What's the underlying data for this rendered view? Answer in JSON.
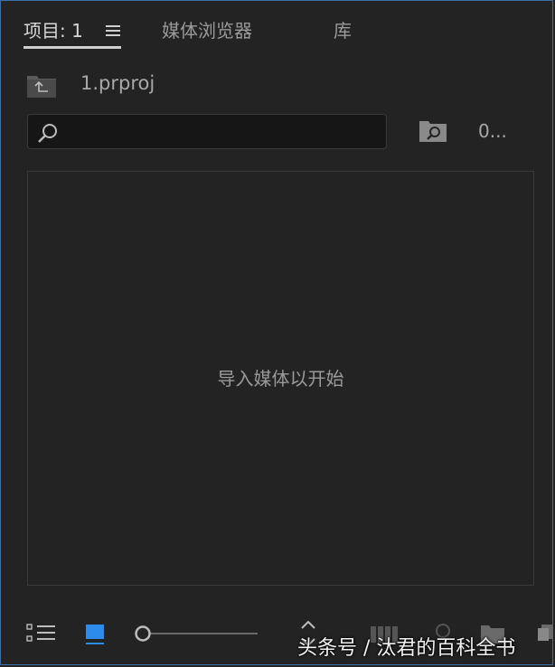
{
  "tabs": [
    {
      "label": "项目: 1",
      "active": true
    },
    {
      "label": "媒体浏览器",
      "active": false
    },
    {
      "label": "库",
      "active": false
    }
  ],
  "project": {
    "name": "1.prproj"
  },
  "search": {
    "placeholder": "",
    "value": ""
  },
  "item_count": "0...",
  "content": {
    "empty_hint": "导入媒体以开始"
  },
  "toolbar": {
    "icons": [
      "list-view-icon",
      "icon-view-icon",
      "zoom-slider",
      "sort-icons-icon",
      "automate-to-sequence-icon",
      "find-icon",
      "new-bin-icon",
      "new-item-icon"
    ]
  },
  "watermark": "头条号 / 汰君的百科全书",
  "colors": {
    "background": "#232323",
    "accent": "#2d8ceb",
    "text": "#a8a8a8",
    "border": "#3a6fa8"
  }
}
